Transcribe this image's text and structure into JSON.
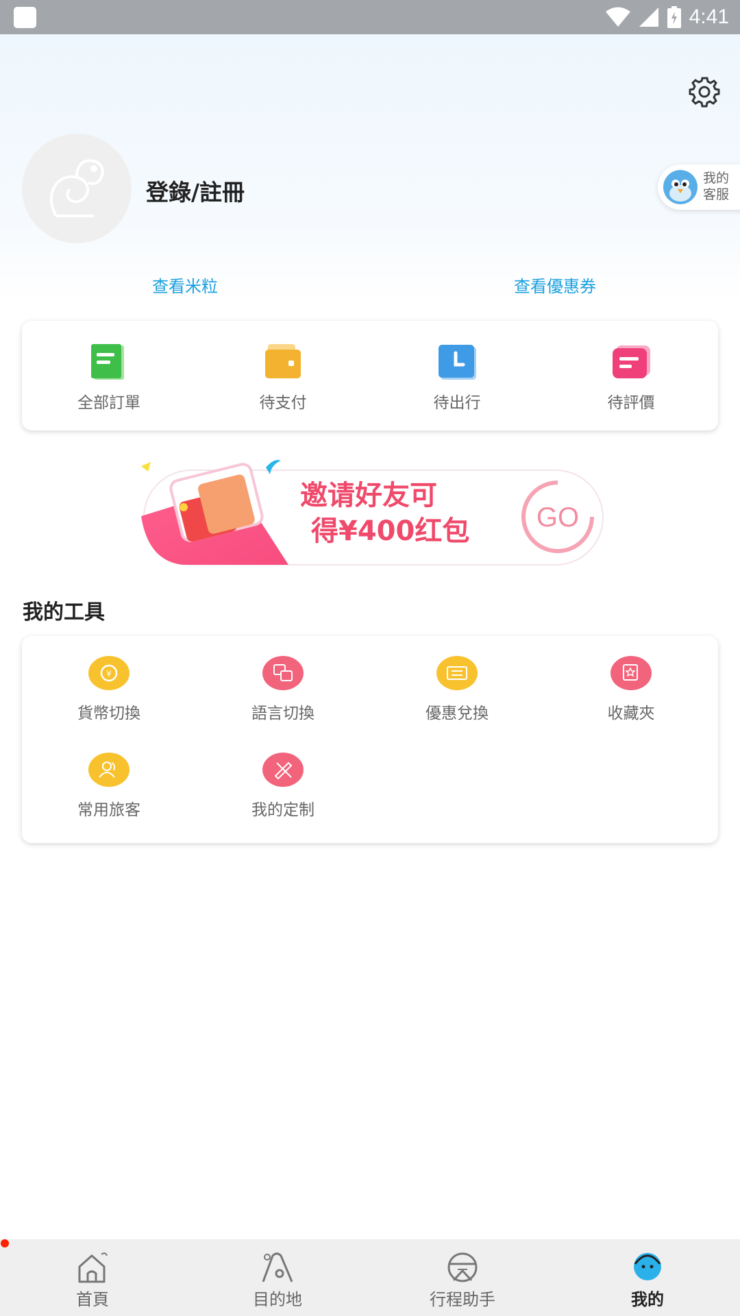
{
  "status_bar": {
    "time": "4:41"
  },
  "profile": {
    "login_label": "登錄/註冊",
    "service_label": "我的客服"
  },
  "quick_links": {
    "rice": "查看米粒",
    "coupons": "查看優惠券"
  },
  "orders": [
    {
      "label": "全部訂單",
      "icon": "all-orders-icon",
      "color": "#4cc552"
    },
    {
      "label": "待支付",
      "icon": "wallet-icon",
      "color": "#f2b233"
    },
    {
      "label": "待出行",
      "icon": "clock-icon",
      "color": "#3d9be6"
    },
    {
      "label": "待評價",
      "icon": "review-icon",
      "color": "#f0407a"
    }
  ],
  "banner": {
    "line1": "邀请好友可",
    "line2": "得¥400红包",
    "go": "GO"
  },
  "tools": {
    "title": "我的工具",
    "items": [
      {
        "label": "貨幣切換",
        "icon": "currency-icon"
      },
      {
        "label": "語言切換",
        "icon": "language-icon"
      },
      {
        "label": "優惠兌換",
        "icon": "ticket-icon"
      },
      {
        "label": "收藏夾",
        "icon": "favorites-icon"
      },
      {
        "label": "常用旅客",
        "icon": "travelers-icon"
      },
      {
        "label": "我的定制",
        "icon": "customize-icon"
      }
    ]
  },
  "nav": [
    {
      "label": "首頁",
      "icon": "home-icon",
      "active": false
    },
    {
      "label": "目的地",
      "icon": "destination-icon",
      "active": false
    },
    {
      "label": "行程助手",
      "icon": "trip-assistant-icon",
      "active": false
    },
    {
      "label": "我的",
      "icon": "profile-icon",
      "active": true
    }
  ]
}
